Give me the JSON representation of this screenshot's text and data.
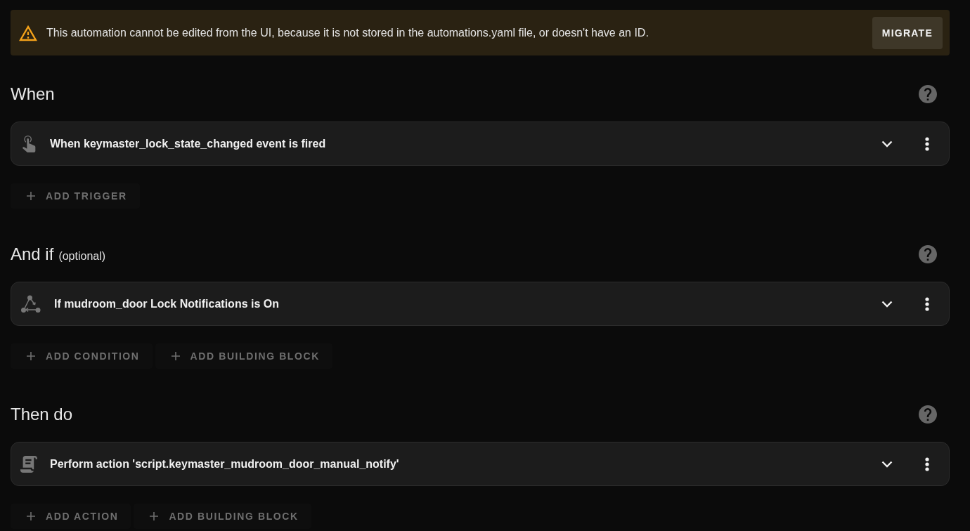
{
  "banner": {
    "message": "This automation cannot be edited from the UI, because it is not stored in the automations.yaml file, or doesn't have an ID.",
    "button": "MIGRATE"
  },
  "sections": [
    {
      "title": "When",
      "items": [
        {
          "kind": "trigger",
          "text": "When keymaster_lock_state_changed event is fired",
          "expanded": false
        }
      ],
      "add_buttons": [
        "ADD TRIGGER"
      ]
    },
    {
      "title": "And if",
      "subtitle": "(optional)",
      "items": [
        {
          "kind": "condition",
          "text": "If mudroom_door Lock Notifications is On",
          "expanded": false
        }
      ],
      "add_buttons": [
        "ADD CONDITION",
        "ADD BUILDING BLOCK"
      ]
    },
    {
      "title": "Then do",
      "items": [
        {
          "kind": "action",
          "text": "Perform action 'script.keymaster_mudroom_door_manual_notify'",
          "expanded": false
        }
      ],
      "add_buttons": [
        "ADD ACTION",
        "ADD BUILDING BLOCK"
      ]
    }
  ]
}
